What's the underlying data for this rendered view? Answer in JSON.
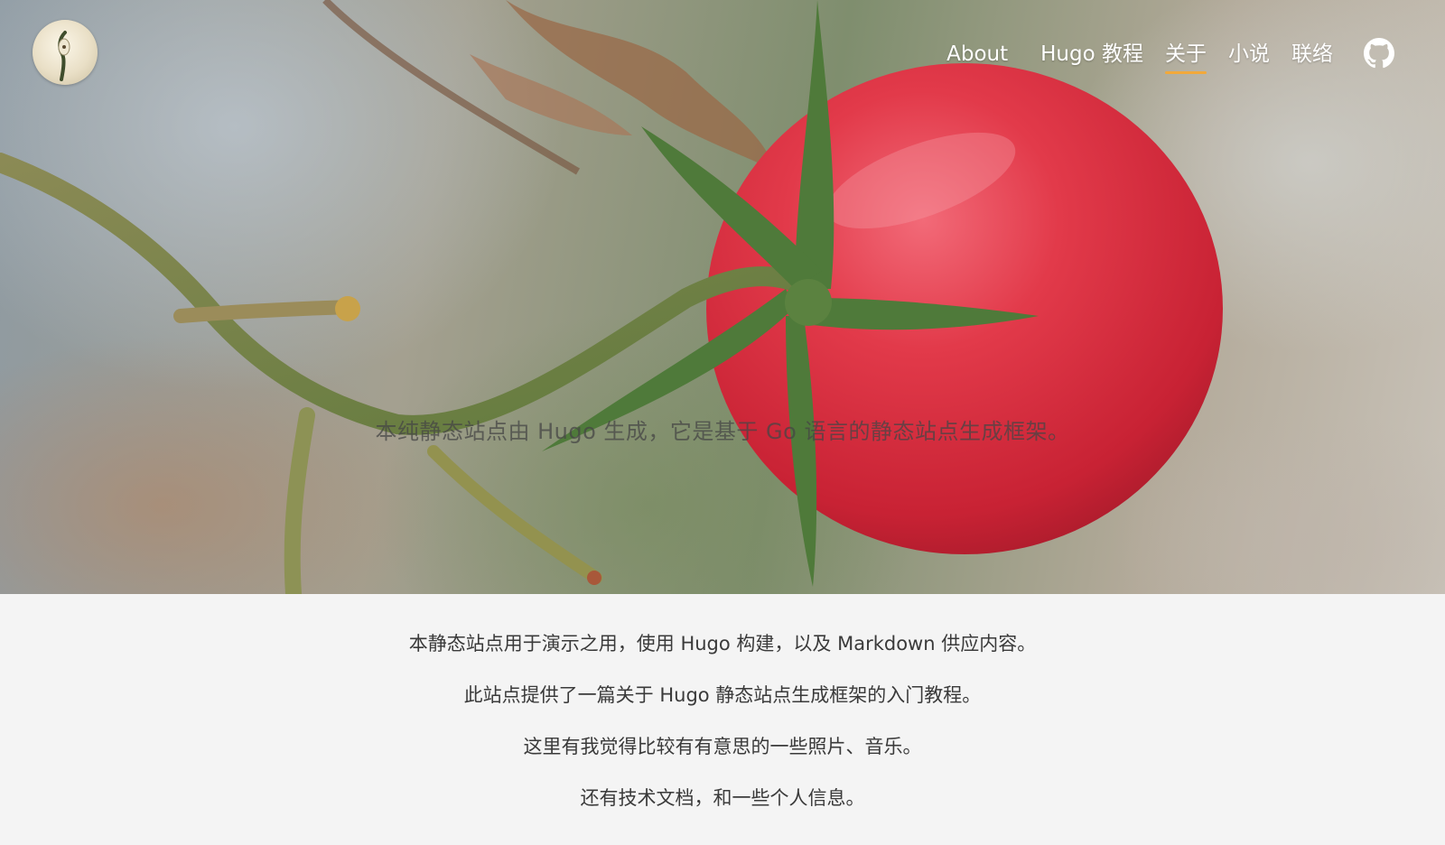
{
  "nav": {
    "items": [
      {
        "label": "About"
      },
      {
        "label": "Hugo 教程"
      },
      {
        "label": "关于",
        "active": true
      },
      {
        "label": "小说"
      },
      {
        "label": "联络"
      }
    ],
    "github_icon": "github-icon",
    "accent_color": "#f2a93b"
  },
  "hero": {
    "caption": "本纯静态站点由 Hugo 生成，它是基于 Go 语言的静态站点生成框架。"
  },
  "content": {
    "paragraphs": [
      "本静态站点用于演示之用，使用 Hugo 构建，以及 Markdown 供应内容。",
      "此站点提供了一篇关于 Hugo 静态站点生成框架的入门教程。",
      "这里有我觉得比较有有意思的一些照片、音乐。",
      "还有技术文档，和一些个人信息。"
    ]
  }
}
